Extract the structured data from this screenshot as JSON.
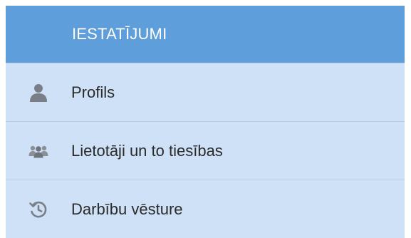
{
  "settings_panel": {
    "title": "IESTATĪJUMI",
    "items": [
      {
        "label": "Profils",
        "icon": "user-icon"
      },
      {
        "label": "Lietotāji un to tiesības",
        "icon": "users-group-icon"
      },
      {
        "label": "Darbību vēsture",
        "icon": "history-icon"
      }
    ]
  },
  "colors": {
    "header_bg": "#5e9fdb",
    "item_bg": "#cfe1f6",
    "icon": "#7a7f87"
  }
}
